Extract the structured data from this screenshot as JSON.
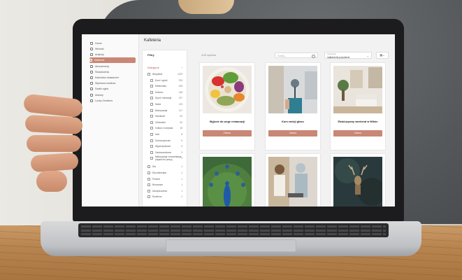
{
  "app": {
    "title": "Kafeteria",
    "sidebar_items": [
      {
        "label": "Home"
      },
      {
        "label": "Wnioski"
      },
      {
        "label": "Artykuły"
      },
      {
        "label": "Kafeteria",
        "active": true
      },
      {
        "label": "Abonamenty"
      },
      {
        "label": "Świadczenia"
      },
      {
        "label": "Kalendarz świadczeń"
      },
      {
        "label": "Wymiana środków"
      },
      {
        "label": "Szafki zgłoś"
      },
      {
        "label": "Ankiety"
      },
      {
        "label": "Lucky Solutions"
      }
    ],
    "filters": {
      "title": "Filtry",
      "category_heading": "Kategoria",
      "categories": [
        {
          "label": "Wszystkie",
          "count": "1129",
          "indent": false
        },
        {
          "label": "Dom i ogród",
          "count": "233",
          "indent": true
        },
        {
          "label": "Elektronika",
          "count": "165",
          "indent": true
        },
        {
          "label": "Dziecko",
          "count": "148",
          "indent": true
        },
        {
          "label": "Sport i rekreacja",
          "count": "137",
          "indent": true
        },
        {
          "label": "Moda",
          "count": "119",
          "indent": true
        },
        {
          "label": "Motoryzacja",
          "count": "117",
          "indent": true
        },
        {
          "label": "Handlowe",
          "count": "64",
          "indent": true
        },
        {
          "label": "Zdrowotne",
          "count": "52",
          "indent": true
        },
        {
          "label": "Kultura i rozrywka",
          "count": "15",
          "indent": true
        },
        {
          "label": "Inne",
          "count": "8",
          "indent": true
        },
        {
          "label": "Dobroczynność",
          "count": "6",
          "indent": true
        },
        {
          "label": "Wypoczynkowe",
          "count": "5",
          "indent": true
        },
        {
          "label": "Gastronomiczne",
          "count": "3",
          "indent": true
        },
        {
          "label": "Maturyzacja i komunikacja (dojazd do pracy)",
          "count": "1",
          "indent": true
        },
        {
          "label": "Dla",
          "count": "1",
          "indent": false
        },
        {
          "label": "Dla zwierzaka",
          "count": "1",
          "indent": false
        },
        {
          "label": "Prezent",
          "count": "1",
          "indent": false
        },
        {
          "label": "Bonusowe",
          "count": "1",
          "indent": false
        },
        {
          "label": "Ubezpieczenia",
          "count": "1",
          "indent": false
        },
        {
          "label": "Rodzinne",
          "count": "1",
          "indent": false
        }
      ]
    },
    "toolbar": {
      "result_count": "1129 wyników",
      "search_placeholder": "Szukaj...",
      "sort_label": "Sortowanie",
      "sort_value": "najbardziej popularne",
      "view_icon": "grid-icon"
    },
    "cards": [
      {
        "title": "Wyjście do wege restauracji",
        "button": "Zobacz"
      },
      {
        "title": "Kurs emisji głosu",
        "button": "Zobacz"
      },
      {
        "title": "Ekskluzywny weekend w Wilnie",
        "button": "Zobacz"
      }
    ],
    "colors": {
      "accent": "#c98775"
    }
  }
}
